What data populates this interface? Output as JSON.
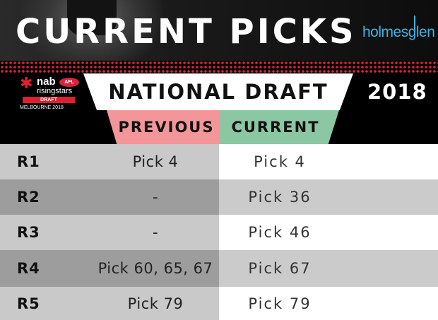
{
  "header": {
    "title": "CURRENT PICKS",
    "brand": "holmesglen"
  },
  "logo": {
    "nab": "nab",
    "afl": "AFL",
    "rising": "risingstars",
    "draft": "DRAFT",
    "location": "MELBOURNE 2018"
  },
  "banner": {
    "title": "NATIONAL DRAFT",
    "year": "2018"
  },
  "columns": {
    "previous": "PREVIOUS",
    "current": "CURRENT"
  },
  "rows": [
    {
      "round": "R1",
      "previous": "Pick 4",
      "current": "Pick 4"
    },
    {
      "round": "R2",
      "previous": "-",
      "current": "Pick 36"
    },
    {
      "round": "R3",
      "previous": "-",
      "current": "Pick 46"
    },
    {
      "round": "R4",
      "previous": "Pick 60, 65, 67",
      "current": "Pick 67"
    },
    {
      "round": "R5",
      "previous": "Pick 79",
      "current": "Pick 79"
    }
  ],
  "colors": {
    "previous_header": "#f29699",
    "current_header": "#8cc7a3",
    "stripe_dots": "#d9243f",
    "brand": "#3fb3e6"
  }
}
